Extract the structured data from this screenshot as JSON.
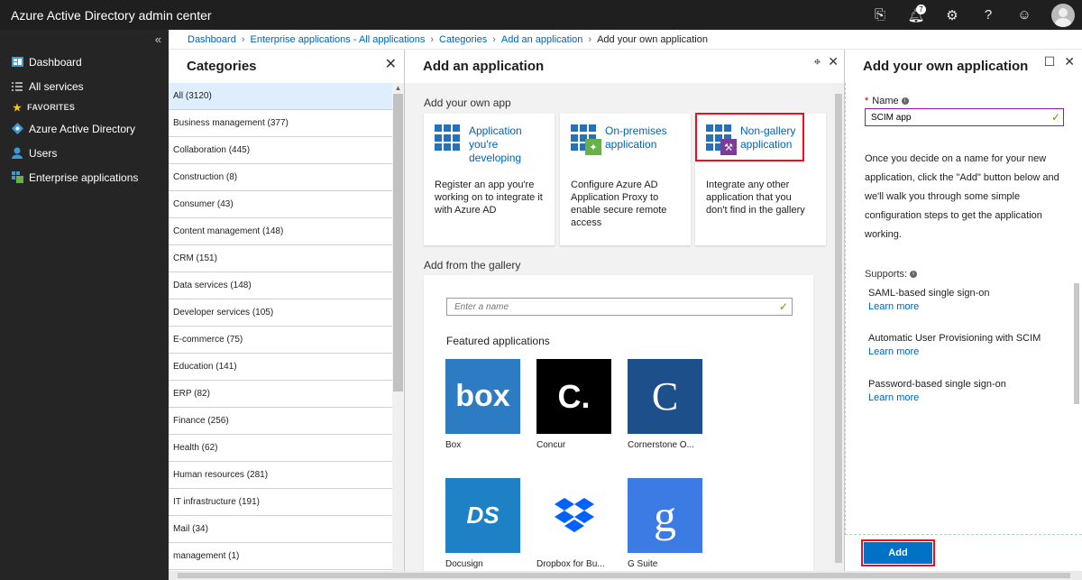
{
  "app": {
    "title": "Azure Active Directory admin center",
    "notification_count": "7",
    "icons": [
      "feedback-icon",
      "bell-icon",
      "gear-icon",
      "help-icon",
      "smiley-icon",
      "avatar"
    ]
  },
  "nav": {
    "collapse_glyph": "«",
    "items": [
      {
        "label": "Dashboard",
        "icon": "dashboard-icon"
      },
      {
        "label": "All services",
        "icon": "list-icon"
      }
    ],
    "favorites_label": "FAVORITES",
    "favorites": [
      {
        "label": "Azure Active Directory",
        "icon": "aad-icon"
      },
      {
        "label": "Users",
        "icon": "users-icon"
      },
      {
        "label": "Enterprise applications",
        "icon": "enterprise-apps-icon"
      }
    ]
  },
  "breadcrumb": {
    "items": [
      "Dashboard",
      "Enterprise applications - All applications",
      "Categories",
      "Add an application"
    ],
    "current": "Add your own application"
  },
  "categories": {
    "title": "Categories",
    "items": [
      "All (3120)",
      "Business management (377)",
      "Collaboration (445)",
      "Construction (8)",
      "Consumer (43)",
      "Content management (148)",
      "CRM (151)",
      "Data services (148)",
      "Developer services (105)",
      "E-commerce (75)",
      "Education (141)",
      "ERP (82)",
      "Finance (256)",
      "Health (62)",
      "Human resources (281)",
      "IT infrastructure (191)",
      "Mail (34)",
      "management (1)"
    ],
    "selected_index": 0
  },
  "add_app": {
    "title": "Add an application",
    "own_section": "Add your own app",
    "cards": [
      {
        "title": "Application you're developing",
        "desc": "Register an app you're working on to integrate it with Azure AD"
      },
      {
        "title": "On-premises application",
        "desc": "Configure Azure AD Application Proxy to enable secure remote access"
      },
      {
        "title": "Non-gallery application",
        "desc": "Integrate any other application that you don't find in the gallery"
      }
    ],
    "gallery_section": "Add from the gallery",
    "search_placeholder": "Enter a name",
    "featured_label": "Featured applications",
    "featured": [
      {
        "name": "Box",
        "logo_text": "box",
        "color": "#2d7bc2"
      },
      {
        "name": "Concur",
        "logo_text": "C.",
        "color": "#000000"
      },
      {
        "name": "Cornerstone O...",
        "logo_text": "C",
        "color": "#1d4f8b"
      },
      {
        "name": "Docusign",
        "logo_text": "DS",
        "color": "#1e80c5"
      },
      {
        "name": "Dropbox for Bu...",
        "logo_text": "",
        "color": "#ffffff"
      },
      {
        "name": "G Suite",
        "logo_text": "g",
        "color": "#3b7be3"
      }
    ]
  },
  "own_app": {
    "title": "Add your own application",
    "name_label": "Name",
    "name_value": "SCIM app",
    "description": "Once you decide on a name for your new application, click the \"Add\" button below and we'll walk you through some simple configuration steps to get the application working.",
    "supports_label": "Supports:",
    "supports": [
      {
        "label": "SAML-based single sign-on",
        "link": "Learn more"
      },
      {
        "label": "Automatic User Provisioning with SCIM",
        "link": "Learn more"
      },
      {
        "label": "Password-based single sign-on",
        "link": "Learn more"
      }
    ],
    "add_label": "Add"
  },
  "colors": {
    "accent": "#0072c6",
    "link": "#0063b1",
    "highlight": "#e81123",
    "topbar": "#1f1f1f",
    "nav": "#252526"
  }
}
